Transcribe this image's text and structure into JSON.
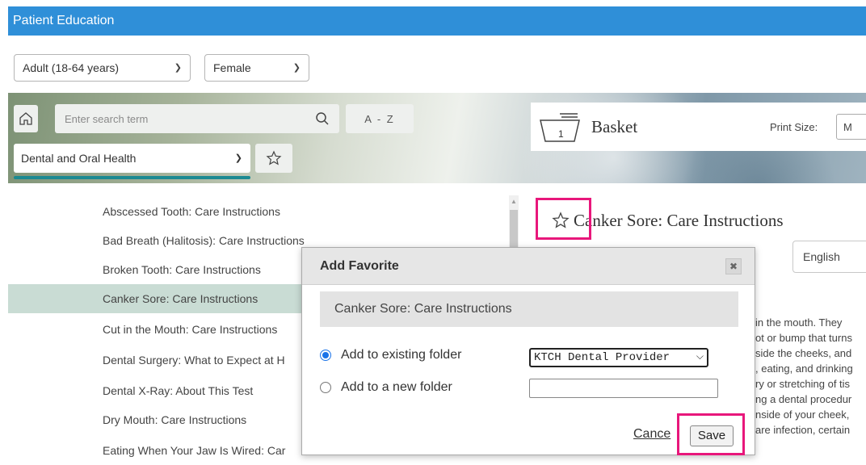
{
  "header": {
    "title": "Patient Education"
  },
  "filters": {
    "age": "Adult (18-64 years)",
    "sex": "Female"
  },
  "search": {
    "placeholder": "Enter search term",
    "az_label": "A - Z",
    "topic": "Dental and Oral Health"
  },
  "basket": {
    "title": "Basket",
    "count": "1",
    "print_size_label": "Print Size:",
    "print_size_value": "M"
  },
  "list": {
    "items": [
      "Abscessed Tooth: Care Instructions",
      "Bad Breath (Halitosis): Care Instructions",
      "Broken Tooth: Care Instructions",
      "Canker Sore: Care Instructions",
      "Cut in the Mouth: Care Instructions",
      "Dental Surgery: What to Expect at H",
      "Dental X-Ray: About This Test",
      "Dry Mouth: Care Instructions",
      "Eating When Your Jaw Is Wired: Car"
    ],
    "selected_index": 3
  },
  "article": {
    "title": "Canker Sore: Care Instructions",
    "language": "English",
    "body_lines": [
      "in the mouth. They",
      "ot or bump that turns",
      "side the cheeks, and",
      ", eating, and drinking",
      "ry or stretching of tis",
      "ng a dental procedur",
      "nside of your cheek,",
      "are infection, certain"
    ]
  },
  "modal": {
    "title": "Add Favorite",
    "close_label": "✖",
    "article_name": "Canker Sore: Care Instructions",
    "existing_label": "Add to existing folder",
    "new_label": "Add to a new folder",
    "folder_value": "KTCH Dental Provider",
    "cancel_label": "Cance",
    "save_label": "Save"
  },
  "colors": {
    "header_bg": "#2f8fd8",
    "highlight": "#e8177b",
    "selected_row": "#c9dcd4",
    "topic_underline": "#1b8a92"
  }
}
